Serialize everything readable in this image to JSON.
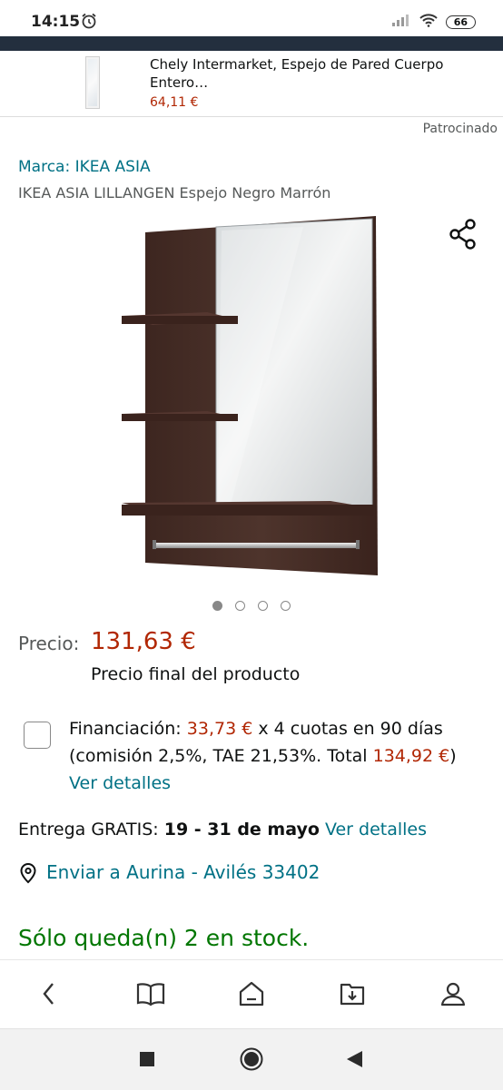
{
  "status_bar": {
    "time": "14:15",
    "battery": "66",
    "icons": [
      "alarm-icon",
      "signal-icon",
      "wifi-icon",
      "battery-icon"
    ]
  },
  "ad": {
    "title": "Chely Intermarket, Espejo de Pared Cuerpo Entero…",
    "price": "64,11 €",
    "sponsored": "Patrocinado"
  },
  "product": {
    "brand": "Marca: IKEA ASIA",
    "title": "IKEA ASIA LILLANGEN Espejo Negro Marrón",
    "image_count": 4,
    "active_image": 0
  },
  "price": {
    "label": "Precio:",
    "value": "131,63 €",
    "note": "Precio final del producto"
  },
  "financing": {
    "prefix": "Financiación: ",
    "installment": "33,73 €",
    "mid": " x 4 cuotas en 90 días (comisión 2,5%, TAE 21,53%. Total ",
    "total": "134,92 €",
    "suffix": ") ",
    "link": "Ver detalles"
  },
  "delivery": {
    "prefix": "Entrega GRATIS: ",
    "dates": "19 - 31 de mayo",
    "link": "Ver detalles"
  },
  "location": {
    "text": "Enviar a Aurina - Avilés 33402"
  },
  "stock": "Sólo queda(n) 2 en stock.",
  "app_nav": [
    "back-icon",
    "book-icon",
    "home-icon",
    "download-icon",
    "account-icon"
  ],
  "system_nav": [
    "recents-icon",
    "home-circle-icon",
    "back-triangle-icon"
  ],
  "colors": {
    "link": "#007185",
    "price": "#b12704",
    "stock": "#007600",
    "header": "#232f3e"
  }
}
